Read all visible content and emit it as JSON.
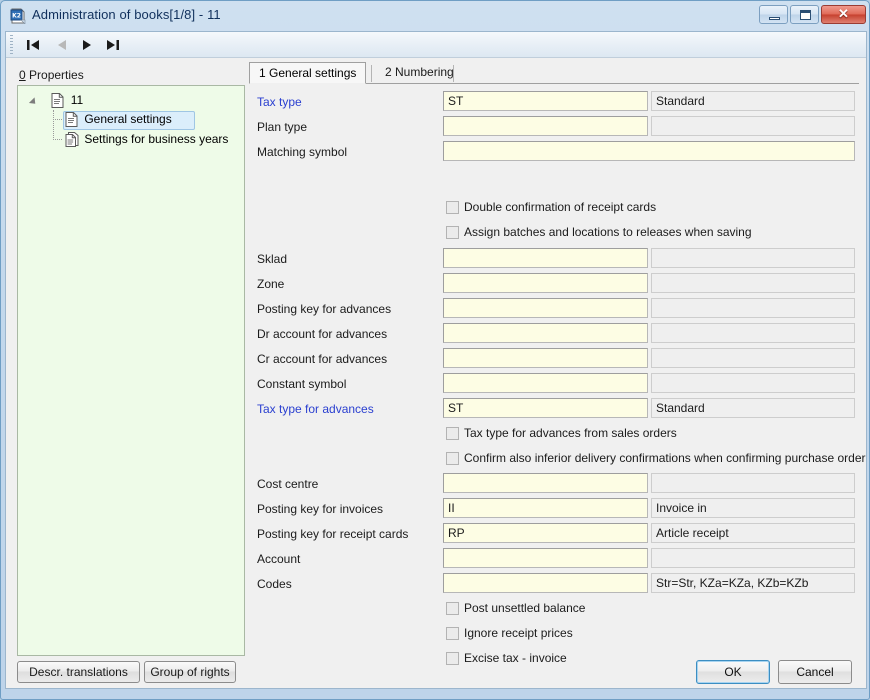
{
  "window": {
    "title": "Administration of books[1/8] - 11",
    "app_icon": "k2-app-icon",
    "minimize_label": "",
    "maximize_label": "",
    "close_label": "✕"
  },
  "toolbar": {
    "buttons": [
      {
        "name": "first-record-button",
        "icon": "first-record-icon",
        "enabled": true
      },
      {
        "name": "previous-record-button",
        "icon": "previous-record-icon",
        "enabled": false
      },
      {
        "name": "next-record-button",
        "icon": "next-record-icon",
        "enabled": true
      },
      {
        "name": "last-record-button",
        "icon": "last-record-icon",
        "enabled": true
      }
    ]
  },
  "tree_panel": {
    "caption_accesskey": "0",
    "caption": " Properties",
    "root": {
      "label": "11",
      "icon": "document-icon",
      "expanded": true
    },
    "children": [
      {
        "label": "General settings",
        "icon": "document-icon",
        "selected": true
      },
      {
        "label": "Settings for business years",
        "icon": "documents-icon",
        "selected": false
      }
    ],
    "buttons": {
      "translations": "Descr. translations",
      "rights": "Group of rights"
    }
  },
  "tabs": [
    {
      "label": "1 General settings",
      "active": true
    },
    {
      "label": "2 Numbering",
      "active": false
    }
  ],
  "form": {
    "rows": [
      {
        "label": "Tax type",
        "blue": true,
        "value": "ST",
        "desc": "Standard",
        "kind": "combo"
      },
      {
        "label": "Plan type",
        "blue": false,
        "value": "",
        "desc": "",
        "kind": "combo"
      },
      {
        "label": "Matching symbol",
        "blue": false,
        "value": "",
        "desc": "",
        "kind": "wide"
      },
      {
        "label": "Sklad",
        "blue": false,
        "value": "",
        "desc": "",
        "kind": "combo"
      },
      {
        "label": "Zone",
        "blue": false,
        "value": "",
        "desc": "",
        "kind": "combo"
      },
      {
        "label": "Posting key for advances",
        "blue": false,
        "value": "",
        "desc": "",
        "kind": "combo"
      },
      {
        "label": "Dr account for advances",
        "blue": false,
        "value": "",
        "desc": "",
        "kind": "combo"
      },
      {
        "label": "Cr account for advances",
        "blue": false,
        "value": "",
        "desc": "",
        "kind": "combo"
      },
      {
        "label": "Constant symbol",
        "blue": false,
        "value": "",
        "desc": "",
        "kind": "combo"
      },
      {
        "label": "Tax type for advances",
        "blue": true,
        "value": "ST",
        "desc": "Standard",
        "kind": "combo"
      },
      {
        "label": "Cost centre",
        "blue": false,
        "value": "",
        "desc": "",
        "kind": "combo"
      },
      {
        "label": "Posting key for invoices",
        "blue": false,
        "value": "II",
        "desc": "Invoice in",
        "kind": "combo"
      },
      {
        "label": "Posting key for receipt cards",
        "blue": false,
        "value": "RP",
        "desc": "Article receipt",
        "kind": "combo"
      },
      {
        "label": "Account",
        "blue": false,
        "value": "",
        "desc": "",
        "kind": "combo"
      },
      {
        "label": "Codes",
        "blue": false,
        "value": "",
        "desc": "Str=Str, KZa=KZa, KZb=KZb",
        "kind": "combo"
      }
    ],
    "checkboxes": [
      {
        "label": "Double confirmation of receipt cards",
        "checked": false
      },
      {
        "label": "Assign batches and locations to releases when saving",
        "checked": false
      },
      {
        "label": "Tax type for advances from sales orders",
        "checked": false
      },
      {
        "label": "Confirm also inferior delivery confirmations when confirming purchase order",
        "checked": false
      },
      {
        "label": "Post unsettled balance",
        "checked": false
      },
      {
        "label": "Ignore receipt prices",
        "checked": false
      },
      {
        "label": "Excise tax - invoice",
        "checked": false
      }
    ]
  },
  "dialog_buttons": {
    "ok": "OK",
    "cancel": "Cancel"
  },
  "colors": {
    "field_background": "#fdfde4",
    "readonly_background": "#efefef",
    "tree_background": "#eefbe8",
    "link_label": "#2b40d0",
    "title_text": "#10305c",
    "close_button": "#c6412f"
  }
}
